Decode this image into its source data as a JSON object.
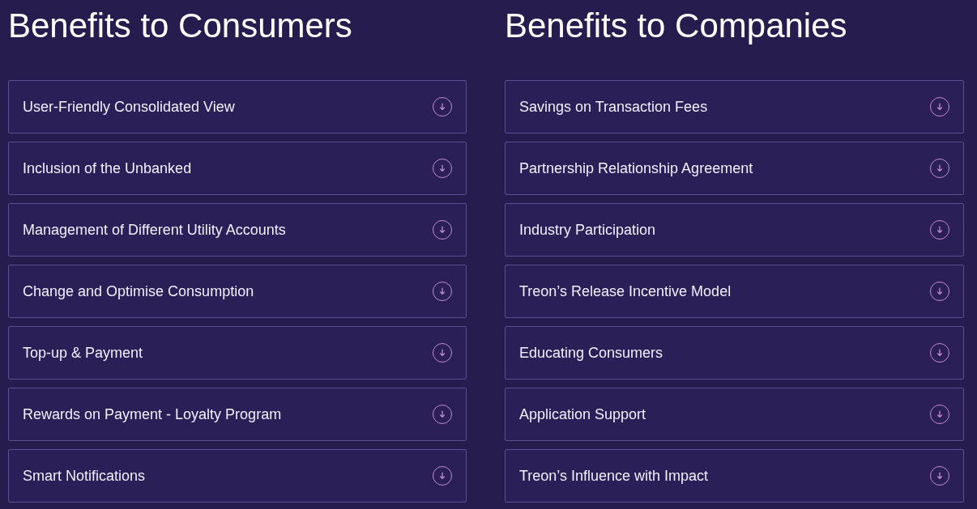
{
  "sections": [
    {
      "title": "Benefits to Consumers",
      "items": [
        {
          "label": "User-Friendly Consolidated View",
          "expanded": false
        },
        {
          "label": "Inclusion of the Unbanked",
          "expanded": false
        },
        {
          "label": "Management of Different Utility Accounts",
          "expanded": false
        },
        {
          "label": "Change and Optimise Consumption",
          "expanded": false
        },
        {
          "label": "Top-up & Payment",
          "expanded": false
        },
        {
          "label": "Rewards on Payment - Loyalty Program",
          "expanded": false
        },
        {
          "label": "Smart Notifications",
          "expanded": false
        }
      ]
    },
    {
      "title": "Benefits to Companies",
      "items": [
        {
          "label": "Savings on Transaction Fees",
          "expanded": false
        },
        {
          "label": "Partnership Relationship Agreement",
          "expanded": false
        },
        {
          "label": "Industry Participation",
          "expanded": false
        },
        {
          "label": "Treon’s Release Incentive Model",
          "expanded": false
        },
        {
          "label": "Educating Consumers",
          "expanded": false
        },
        {
          "label": "Application Support",
          "expanded": false
        },
        {
          "label": "Treon’s Influence with Impact",
          "expanded": false
        }
      ]
    }
  ]
}
